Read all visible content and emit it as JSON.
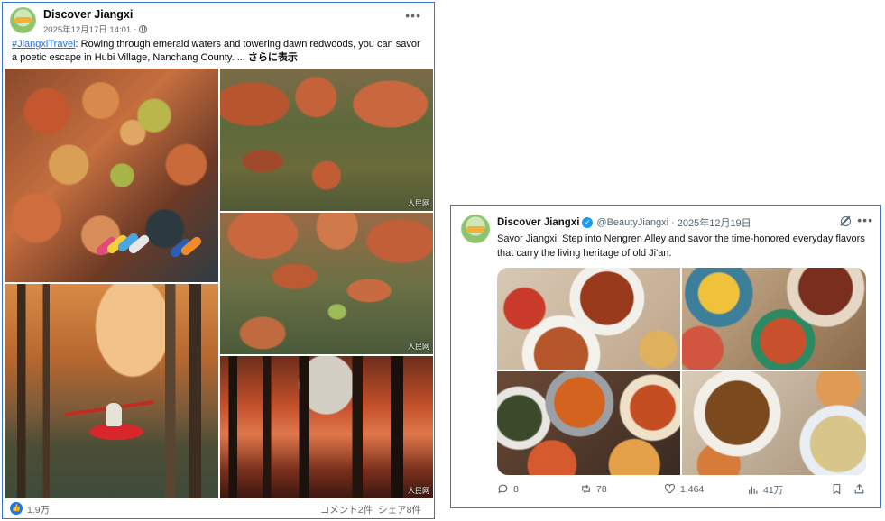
{
  "facebook_post": {
    "page_name": "Discover Jiangxi",
    "timestamp": "2025年12月17日 14:01",
    "meta_separator": "·",
    "more_label": "•••",
    "hashtag": "#JiangxiTravel",
    "text": ": Rowing through emerald waters and towering dawn redwoods, you can savor a poetic escape in Hubi Village, Nanchang County. ... ",
    "see_more": "さらに表示",
    "watermark": "人民网",
    "likes": "1.9万",
    "comments": "コメント2件",
    "shares": "シェア8件",
    "like_icon": "thumbs-up-icon"
  },
  "x_post": {
    "display_name": "Discover Jiangxi",
    "handle": "@BeautyJiangxi",
    "separator": "·",
    "date": "2025年12月19日",
    "more_label": "•••",
    "text": "Savor Jiangxi: Step into Nengren Alley and savor the time-honored everyday flavors that carry the living heritage of old Ji'an.",
    "actions": {
      "replies": "8",
      "reposts": "78",
      "likes": "1,464",
      "views": "41万"
    }
  },
  "colors": {
    "card_border": "#3b73c9",
    "facebook_blue": "#1877f2",
    "hashtag_blue": "#216fdb",
    "x_verified": "#1d9bf0",
    "secondary_text": "#65676b"
  }
}
